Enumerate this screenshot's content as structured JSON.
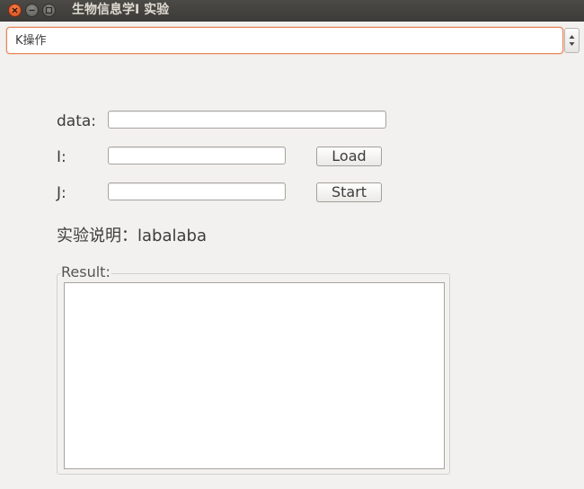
{
  "window": {
    "title": "生物信息学I 实验"
  },
  "mode_select": {
    "selected": "K操作"
  },
  "form": {
    "data_label": "data:",
    "data_value": "",
    "i_label": "I:",
    "i_value": "",
    "j_label": "J:",
    "j_value": "",
    "load_label": "Load",
    "start_label": "Start"
  },
  "description": "实验说明：labalaba",
  "result": {
    "title": "Result:",
    "content": ""
  },
  "colors": {
    "titlebar": "#3c3b37",
    "close_button": "#e65a25",
    "focus_border": "#e7865a",
    "background": "#f2f1f0"
  }
}
